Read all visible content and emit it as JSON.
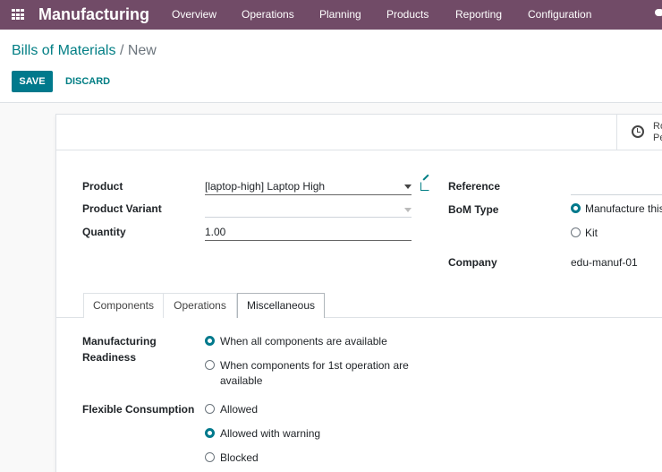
{
  "navbar": {
    "app_name": "Manufacturing",
    "menu": [
      "Overview",
      "Operations",
      "Planning",
      "Products",
      "Reporting",
      "Configuration"
    ]
  },
  "breadcrumb": {
    "parent": "Bills of Materials",
    "separator": "/",
    "current": "New"
  },
  "actions": {
    "save": "SAVE",
    "discard": "DISCARD"
  },
  "stat_button": {
    "line1": "Ro",
    "line2": "Pe"
  },
  "form": {
    "product_label": "Product",
    "product_value": "[laptop-high] Laptop High",
    "variant_label": "Product Variant",
    "variant_value": "",
    "quantity_label": "Quantity",
    "quantity_value": "1.00",
    "reference_label": "Reference",
    "reference_value": "",
    "bom_type_label": "BoM Type",
    "bom_type_options": [
      "Manufacture this",
      "Kit"
    ],
    "bom_type_selected": "Manufacture this",
    "company_label": "Company",
    "company_value": "edu-manuf-01"
  },
  "tabs": [
    "Components",
    "Operations",
    "Miscellaneous"
  ],
  "active_tab": "Miscellaneous",
  "misc": {
    "readiness_label_1": "Manufacturing",
    "readiness_label_2": "Readiness",
    "readiness_opt1": "When all components are available",
    "readiness_opt2_line1": "When components for 1st operation are",
    "readiness_opt2_line2": "available",
    "readiness_selected": "When all components are available",
    "consumption_label": "Flexible Consumption",
    "consumption_options": [
      "Allowed",
      "Allowed with warning",
      "Blocked"
    ],
    "consumption_selected": "Allowed with warning"
  },
  "colors": {
    "navbar": "#714b67",
    "primary": "#00798c",
    "link": "#017e84"
  }
}
